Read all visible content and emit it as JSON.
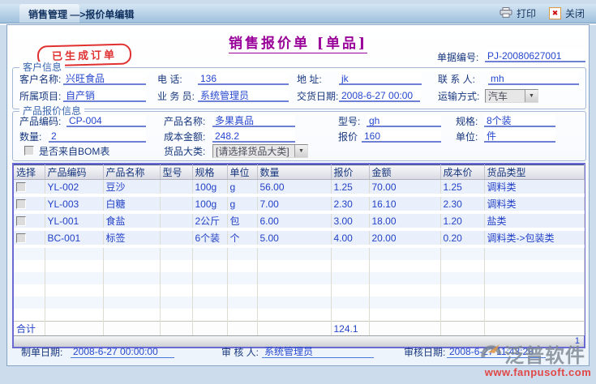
{
  "colors": {
    "title_purple": "#990099",
    "stamp_red": "#e03030",
    "label_navy": "#17377e",
    "value_blue": "#2547cf",
    "table_border_purple": "#6a6ad2",
    "watermark_red": "#e04848"
  },
  "icons": {
    "dropdown_arrow": "▼",
    "close_x": "✖"
  },
  "window": {
    "title": "销售管理 —>报价单编辑",
    "print_label": "打印",
    "close_label": "关闭"
  },
  "header": {
    "title": "销售报价单 [单品]",
    "stamp": "已生成订单",
    "doc_no_label": "单据编号:",
    "doc_no": "PJ-20080627001"
  },
  "customer": {
    "legend": "客户信息",
    "name_label": "客户名称:",
    "name": "兴旺食品",
    "phone_label": "电 话:",
    "phone": "136",
    "address_label": "地 址:",
    "address": "jk",
    "contact_label": "联 系 人:",
    "contact": "mh",
    "project_label": "所属项目:",
    "project": "自产销",
    "salesman_label": "业 务 员:",
    "salesman": "系统管理员",
    "delivery_label": "交货日期:",
    "delivery": "2008-6-27 00:00",
    "transport_label": "运输方式:",
    "transport": "汽车"
  },
  "product": {
    "legend": "产品报价信息",
    "code_label": "产品编码:",
    "code": "CP-004",
    "name_label": "产品名称:",
    "name": "多果真品",
    "model_label": "型号:",
    "model": "gh",
    "spec_label": "规格:",
    "spec": "8个装",
    "qty_label": "数量:",
    "qty": "2",
    "cost_label": "成本金额:",
    "cost": "248.2",
    "price_label": "报价",
    "price": "160",
    "unit_label": "单位:",
    "unit": "件",
    "bom_label": "是否来自BOM表",
    "category_label": "货品大类:",
    "category": "[请选择货品大类]"
  },
  "table": {
    "headers": [
      "选择",
      "产品编码",
      "产品名称",
      "型号",
      "规格",
      "单位",
      "数量",
      "报价",
      "金额",
      "成本价",
      "货品类型"
    ],
    "rows": [
      {
        "code": "YL-002",
        "name": "豆沙",
        "model": "",
        "spec": "100g",
        "unit": "g",
        "qty": "56.00",
        "price": "1.25",
        "amount": "70.00",
        "cost": "1.25",
        "type": "调料类"
      },
      {
        "code": "YL-003",
        "name": "白糖",
        "model": "",
        "spec": "100g",
        "unit": "g",
        "qty": "7.00",
        "price": "2.30",
        "amount": "16.10",
        "cost": "2.30",
        "type": "调料类"
      },
      {
        "code": "YL-001",
        "name": "食盐",
        "model": "",
        "spec": "2公斤",
        "unit": "包",
        "qty": "6.00",
        "price": "3.00",
        "amount": "18.00",
        "cost": "1.20",
        "type": "盐类"
      },
      {
        "code": "BC-001",
        "name": "标签",
        "model": "",
        "spec": "6个装",
        "unit": "个",
        "qty": "5.00",
        "price": "4.00",
        "amount": "20.00",
        "cost": "0.20",
        "type": "调料类->包装类"
      }
    ],
    "total_label": "合计",
    "total_amount": "124.1",
    "page_number": "1"
  },
  "footer": {
    "made_label": "制单日期:",
    "made_date": "2008-6-27 00:00:00",
    "auditor_label": "审 核 人:",
    "auditor": "系统管理员",
    "audit_label": "审核日期:",
    "audit_date": "2008-6-27 11:43:28"
  },
  "watermark": {
    "brand": "泛普软件",
    "url": "www.fanpusoft.com"
  }
}
